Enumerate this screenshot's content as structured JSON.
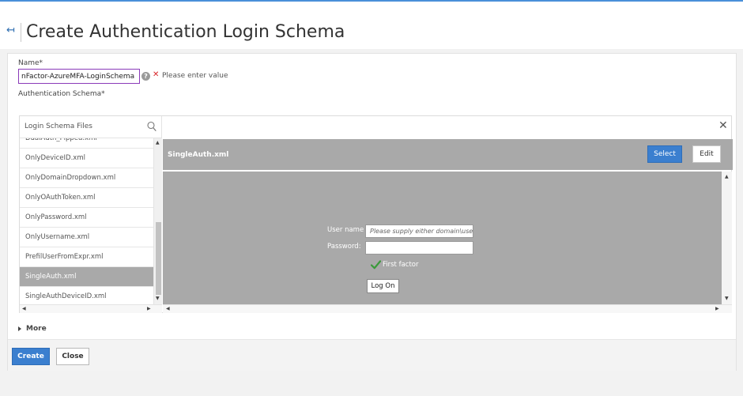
{
  "page": {
    "title": "Create Authentication Login Schema",
    "back_glyph": "↤"
  },
  "form": {
    "name_label": "Name*",
    "name_value": "nFactor-AzureMFA-LoginSchema",
    "help_glyph": "?",
    "error_glyph": "✕",
    "error_message": "Please enter value",
    "schema_label": "Authentication Schema*"
  },
  "browser": {
    "list_title": "Login Schema Files",
    "close_glyph": "✕",
    "files": [
      "DualAuth_Pipped.xml",
      "OnlyDeviceID.xml",
      "OnlyDomainDropdown.xml",
      "OnlyOAuthToken.xml",
      "OnlyPassword.xml",
      "OnlyUsername.xml",
      "PrefilUserFromExpr.xml",
      "SingleAuth.xml",
      "SingleAuthDeviceID.xml"
    ],
    "selected_file": "SingleAuth.xml",
    "scroll_up": "▲",
    "scroll_down": "▼",
    "scroll_left": "◀",
    "scroll_right": "▶"
  },
  "preview": {
    "title": "SingleAuth.xml",
    "select_label": "Select",
    "edit_label": "Edit",
    "username_label": "User name",
    "username_placeholder": "Please supply either domain\\use...",
    "password_label": "Password:",
    "factor_label": "First factor",
    "logon_label": "Log On"
  },
  "more": {
    "label": "More"
  },
  "footer": {
    "create_label": "Create",
    "close_label": "Close"
  },
  "colors": {
    "primary": "#3b7fcf",
    "error": "#d9252a",
    "selected": "#a9a9a9",
    "check": "#3a9a3a"
  },
  "icons": {
    "search": "search-icon",
    "help": "help-icon",
    "close": "close-icon",
    "back": "back-arrow-icon",
    "check": "checkmark-icon",
    "expand": "caret-right-icon"
  }
}
